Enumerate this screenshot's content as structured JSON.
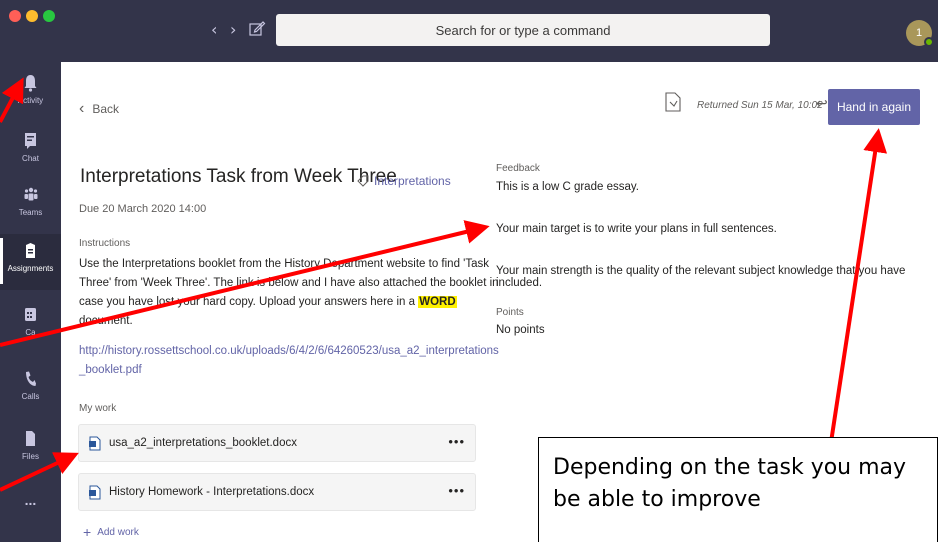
{
  "titlebar": {
    "search_placeholder": "Search for or type a command",
    "avatar_initial": "1"
  },
  "rail": {
    "items": [
      {
        "label": "Activity",
        "icon": "bell-icon"
      },
      {
        "label": "Chat",
        "icon": "chat-icon"
      },
      {
        "label": "Teams",
        "icon": "teams-icon"
      },
      {
        "label": "Assignments",
        "icon": "assignments-icon"
      },
      {
        "label": "Ca",
        "icon": "calendar-icon"
      },
      {
        "label": "Calls",
        "icon": "phone-icon"
      },
      {
        "label": "Files",
        "icon": "files-icon"
      },
      {
        "label": "...",
        "icon": "more-icon"
      }
    ],
    "active": "Assignments"
  },
  "header": {
    "back_label": "Back",
    "returned_text": "Returned Sun 15 Mar, 10:02",
    "undo_glyph": "↩",
    "hand_in_label": "Hand in again"
  },
  "assignment": {
    "title": "Interpretations Task from Week Three",
    "tag": "Interpretations",
    "due": "Due 20 March 2020 14:00",
    "instructions_label": "Instructions",
    "instructions_before": "Use the Interpretations booklet from the History Department website to find 'Task Three' from 'Week Three'. The link is below and I have also attached the booklet in case you have lost your hard copy. Upload your answers here in a ",
    "instructions_highlight": "WORD",
    "instructions_after": " document.",
    "link": "http://history.rossettschool.co.uk/uploads/6/4/2/6/64260523/usa_a2_interpretations_booklet.pdf",
    "my_work_label": "My work",
    "work_items": [
      {
        "name": "usa_a2_interpretations_booklet.docx",
        "more": "•••"
      },
      {
        "name": "History Homework - Interpretations.docx",
        "more": "•••"
      }
    ],
    "add_work_label": "Add work"
  },
  "feedback": {
    "label": "Feedback",
    "lines": [
      "This is a low C grade essay.",
      "Your main target is to write your plans in full sentences.",
      "Your main strength is the quality of the relevant subject knowledge that you have included."
    ],
    "points_label": "Points",
    "points_value": "No points"
  },
  "callout": {
    "text": "Depending on the task you may be able to improve"
  },
  "colors": {
    "accent": "#6264a7",
    "rail": "#33344a",
    "annotation": "#ff0000"
  }
}
